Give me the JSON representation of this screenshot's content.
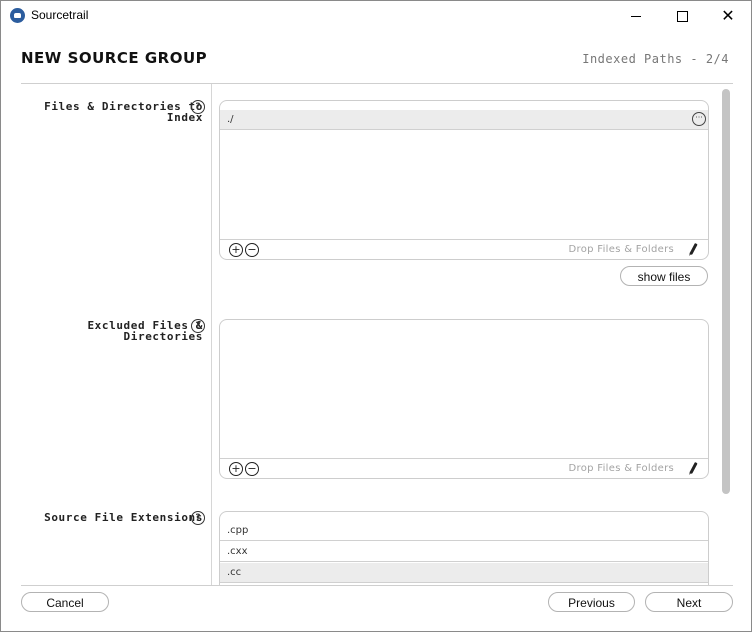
{
  "window": {
    "title": "Sourcetrail"
  },
  "header": {
    "title": "NEW SOURCE GROUP",
    "step": "Indexed Paths - 2/4"
  },
  "fields": {
    "include": {
      "label_line1": "Files & Directories to",
      "label_line2": "Index",
      "items": [
        "./"
      ],
      "drop_hint": "Drop Files & Folders",
      "show_files_label": "show files"
    },
    "exclude": {
      "label_line1": "Excluded Files &",
      "label_line2": "Directories",
      "items": [],
      "drop_hint": "Drop Files & Folders"
    },
    "extensions": {
      "label_line1": "Source File Extensions",
      "items": [
        ".cpp",
        ".cxx",
        ".cc"
      ]
    }
  },
  "icons": {
    "help": "?",
    "more": "···",
    "add": "+",
    "remove": "−"
  },
  "footer": {
    "cancel_label": "Cancel",
    "previous_label": "Previous",
    "next_label": "Next"
  }
}
